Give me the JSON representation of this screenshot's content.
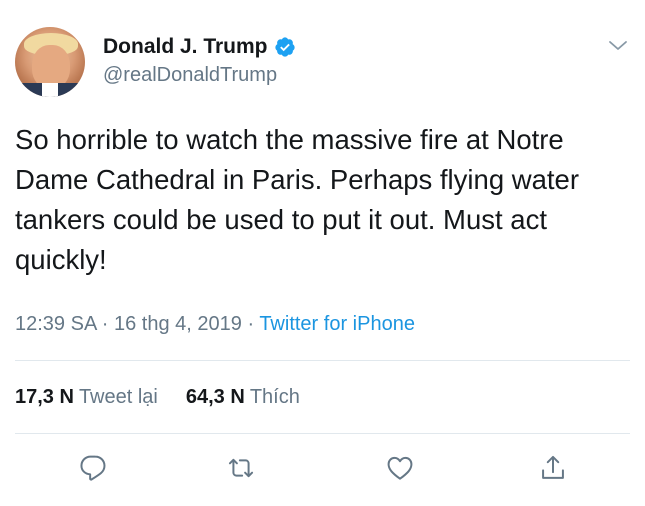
{
  "user": {
    "display_name": "Donald J. Trump",
    "handle": "@realDonaldTrump",
    "verified": true
  },
  "tweet": {
    "text": "So horrible to watch the massive fire at Notre Dame Cathedral in Paris. Perhaps flying water tankers could be used to put it out. Must act quickly!",
    "time": "12:39 SA",
    "date": "16 thg 4, 2019",
    "separator": "·",
    "source": "Twitter for iPhone"
  },
  "stats": {
    "retweets_count": "17,3 N",
    "retweets_label": "Tweet lại",
    "likes_count": "64,3 N",
    "likes_label": "Thích"
  },
  "icons": {
    "verified": "verified-badge-icon",
    "menu": "chevron-down-icon",
    "reply": "reply-icon",
    "retweet": "retweet-icon",
    "like": "heart-icon",
    "share": "share-icon"
  },
  "colors": {
    "accent": "#1DA1F2",
    "text": "#14171A",
    "secondary": "#657786",
    "link": "#1B95E0",
    "divider": "#E1E8ED"
  }
}
